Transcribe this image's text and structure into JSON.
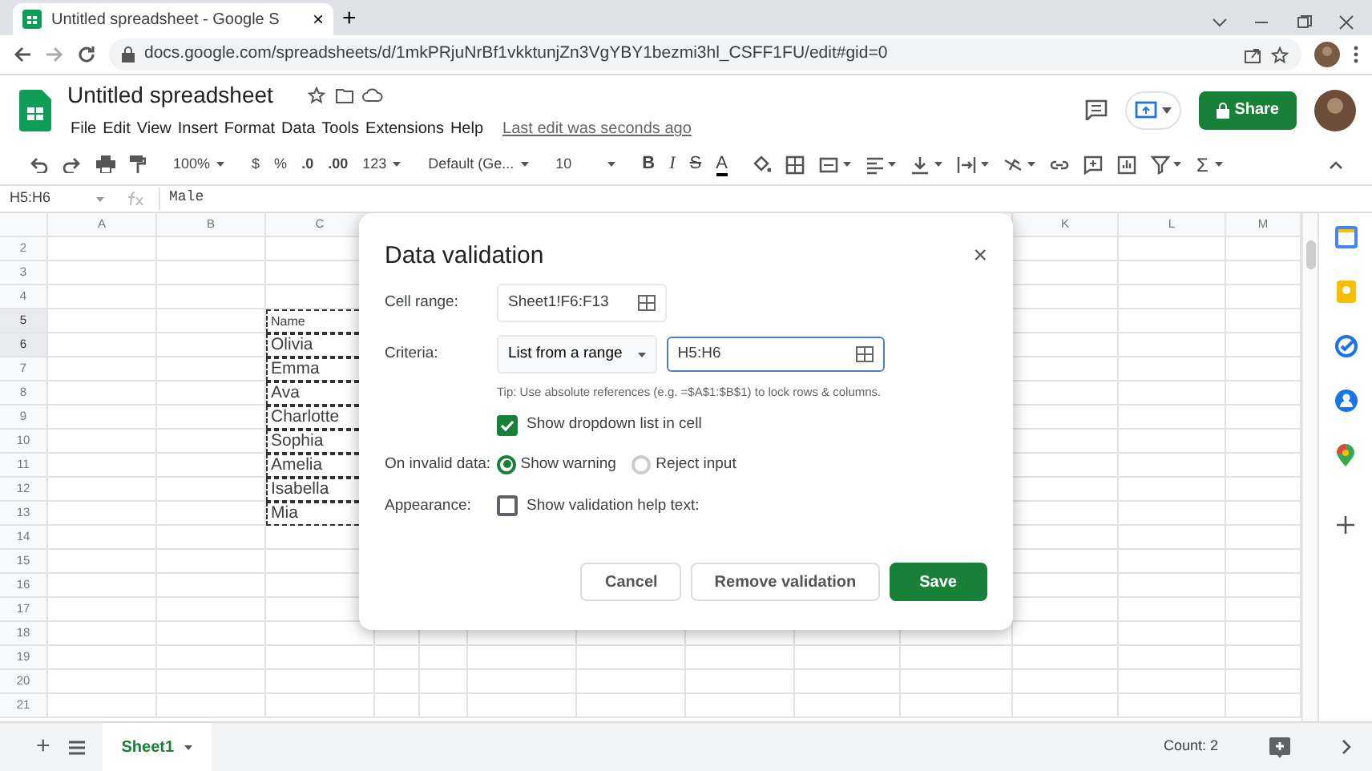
{
  "browser": {
    "tab_title": "Untitled spreadsheet - Google S",
    "tab_close": "×",
    "new_tab": "+",
    "url": "docs.google.com/spreadsheets/d/1mkPRjuNrBf1vkktunjZn3VgYBY1bezmi3hl_CSFF1FU/edit#gid=0"
  },
  "app": {
    "title": "Untitled spreadsheet",
    "menus": [
      "File",
      "Edit",
      "View",
      "Insert",
      "Format",
      "Data",
      "Tools",
      "Extensions",
      "Help"
    ],
    "last_edit": "Last edit was seconds ago",
    "share": "Share"
  },
  "toolbar": {
    "zoom": "100%",
    "currency": "$",
    "percent": "%",
    "decrease_decimals": ".0",
    "increase_decimals": ".00",
    "more_formats": "123",
    "font": "Default (Ge...",
    "font_size": "10",
    "bold": "B",
    "italic": "I",
    "strike": "S",
    "text_color": "A",
    "functions": "Σ"
  },
  "formula_bar": {
    "cell_ref": "H5:H6",
    "content": "Male"
  },
  "grid": {
    "columns_left": [
      "A",
      "B",
      "C"
    ],
    "columns_right": [
      "K",
      "L",
      "M"
    ],
    "rows": [
      {
        "number": "2",
        "selected": false
      },
      {
        "number": "3",
        "selected": false
      },
      {
        "number": "4",
        "selected": false
      },
      {
        "number": "5",
        "selected": true,
        "column_c": "Name",
        "kind": "header"
      },
      {
        "number": "6",
        "selected": true,
        "column_c": "Olivia"
      },
      {
        "number": "7",
        "selected": false,
        "column_c": "Emma"
      },
      {
        "number": "8",
        "selected": false,
        "column_c": "Ava"
      },
      {
        "number": "9",
        "selected": false,
        "column_c": "Charlotte"
      },
      {
        "number": "10",
        "selected": false,
        "column_c": "Sophia"
      },
      {
        "number": "11",
        "selected": false,
        "column_c": "Amelia"
      },
      {
        "number": "12",
        "selected": false,
        "column_c": "Isabella"
      },
      {
        "number": "13",
        "selected": false,
        "column_c": "Mia"
      },
      {
        "number": "14",
        "selected": false
      },
      {
        "number": "15",
        "selected": false
      },
      {
        "number": "16",
        "selected": false
      },
      {
        "number": "17",
        "selected": false
      },
      {
        "number": "18",
        "selected": false
      },
      {
        "number": "19",
        "selected": false
      },
      {
        "number": "20",
        "selected": false
      },
      {
        "number": "21",
        "selected": false
      }
    ]
  },
  "dialog": {
    "title": "Data validation",
    "close": "×",
    "cell_range_label": "Cell range:",
    "cell_range": "Sheet1!F6:F13",
    "criteria_label": "Criteria:",
    "criteria": "List from a range",
    "criteria_range": "H5:H6",
    "tip": "Tip: Use absolute references (e.g. =$A$1:$B$1) to lock rows & columns.",
    "show_dropdown": {
      "label": "Show dropdown list in cell",
      "checked": true
    },
    "invalid_label": "On invalid data:",
    "invalid_options": [
      {
        "label": "Show warning",
        "selected": true
      },
      {
        "label": "Reject input",
        "selected": false
      }
    ],
    "appearance_label": "Appearance:",
    "help_text": {
      "label": "Show validation help text:",
      "checked": false
    },
    "buttons": {
      "cancel": "Cancel",
      "remove": "Remove validation",
      "save": "Save"
    }
  },
  "sheets": {
    "add": "+",
    "tabs": [
      {
        "label": "Sheet1",
        "selected": true
      }
    ],
    "count": "Count: 2"
  }
}
